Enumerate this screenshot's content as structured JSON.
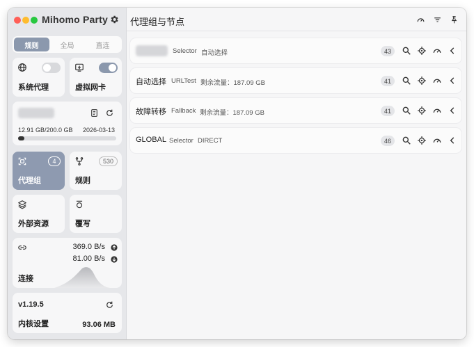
{
  "app": {
    "title": "Mihomo Party"
  },
  "mode": {
    "tabs": [
      "规则",
      "全局",
      "直连"
    ],
    "active_index": 0
  },
  "sidebar": {
    "system_proxy": {
      "label": "系统代理",
      "enabled": false,
      "icon": "globe-icon"
    },
    "tun": {
      "label": "虚拟网卡",
      "enabled": true,
      "icon": "tun-icon"
    },
    "subscription": {
      "usage": "12.91 GB/200.0 GB",
      "expire": "2026-03-13",
      "progress": 0.0646
    },
    "proxy_groups": {
      "label": "代理组",
      "count": "4"
    },
    "rules": {
      "label": "规则",
      "count": "530"
    },
    "external_resources": {
      "label": "外部资源"
    },
    "override": {
      "label": "覆写"
    },
    "connections": {
      "label": "连接",
      "upload": "369.0 B/s",
      "download": "81.00 B/s"
    },
    "core": {
      "version": "v1.19.5",
      "label": "内核设置",
      "memory": "93.06 MB"
    }
  },
  "main": {
    "title": "代理组与节点",
    "groups": [
      {
        "name": "",
        "type": "Selector",
        "now": "自动选择",
        "count": "43",
        "blurred": true
      },
      {
        "name": "自动选择",
        "type": "URLTest",
        "now": "剩余流量：187.09 GB",
        "count": "41",
        "blurred": false
      },
      {
        "name": "故障转移",
        "type": "Fallback",
        "now": "剩余流量：187.09 GB",
        "count": "41",
        "blurred": false
      },
      {
        "name": "GLOBAL",
        "type": "Selector",
        "now": "DIRECT",
        "count": "46",
        "blurred": false
      }
    ]
  },
  "colors": {
    "accent": "#8b98ad",
    "selected_card": "#8e9ab0"
  }
}
